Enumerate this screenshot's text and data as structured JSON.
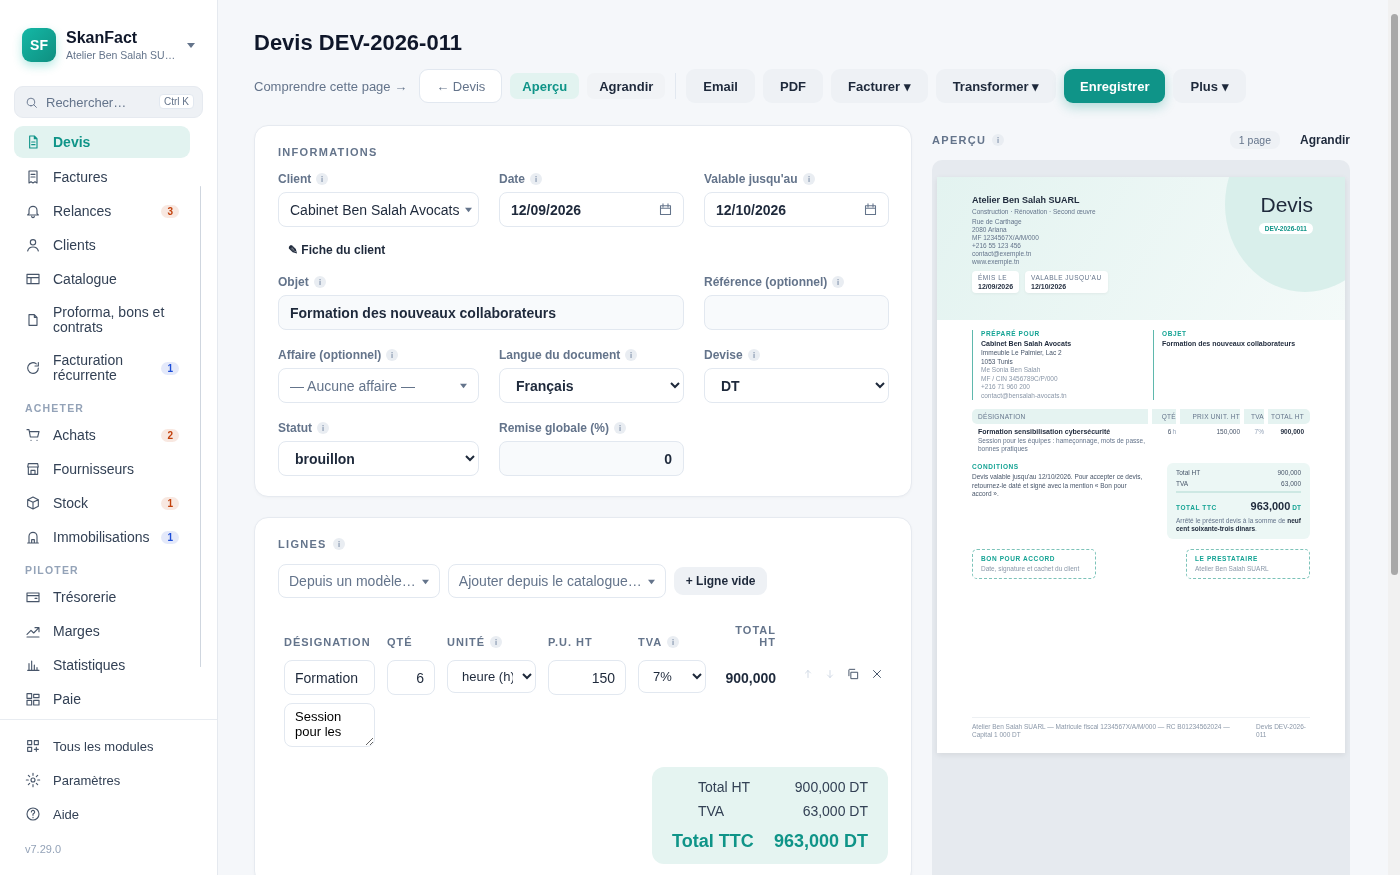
{
  "app": {
    "logo": "SF",
    "name": "SkanFact",
    "company": "Atelier Ben Salah SU…"
  },
  "search": {
    "placeholder": "Rechercher…",
    "shortcut": "Ctrl K"
  },
  "nav": [
    {
      "kind": "item",
      "label": "Devis",
      "selected": true
    },
    {
      "kind": "item",
      "label": "Factures",
      "selected": false
    },
    {
      "kind": "item",
      "label": "Relances",
      "selected": false,
      "badge": "3",
      "color": "#c2410c"
    },
    {
      "kind": "item",
      "label": "Clients",
      "selected": false
    },
    {
      "kind": "item",
      "label": "Catalogue",
      "selected": false
    },
    {
      "kind": "item",
      "label": "Proforma, bons et contrats",
      "selected": false
    },
    {
      "kind": "item",
      "label": "Facturation récurrente",
      "selected": false,
      "badge": "1",
      "color": "#1d4ed8"
    },
    {
      "kind": "section",
      "label": "ACHETER"
    },
    {
      "kind": "item",
      "label": "Achats",
      "selected": false,
      "badge": "2",
      "color": "#c2410c"
    },
    {
      "kind": "item",
      "label": "Fournisseurs",
      "selected": false
    },
    {
      "kind": "item",
      "label": "Stock",
      "selected": false,
      "badge": "1",
      "color": "#c2410c"
    },
    {
      "kind": "item",
      "label": "Immobilisations",
      "selected": false,
      "badge": "1",
      "color": "#1d4ed8"
    },
    {
      "kind": "section",
      "label": "PILOTER"
    },
    {
      "kind": "item",
      "label": "Trésorerie",
      "selected": false
    },
    {
      "kind": "item",
      "label": "Marges",
      "selected": false
    },
    {
      "kind": "item",
      "label": "Statistiques",
      "selected": false
    },
    {
      "kind": "item",
      "label": "Paie",
      "selected": false
    }
  ],
  "footer_nav": [
    {
      "label": "Tous les modules"
    },
    {
      "label": "Paramètres"
    },
    {
      "label": "Aide"
    }
  ],
  "version": "v7.29.0",
  "page": {
    "title": "Devis DEV-2026-011"
  },
  "toolbar": [
    {
      "kind": "link",
      "label": "Comprendre cette page →"
    },
    {
      "kind": "back",
      "label": "← Devis"
    },
    {
      "kind": "toggle",
      "label": "Aperçu",
      "selected": true
    },
    {
      "kind": "toggle",
      "label": "Agrandir",
      "selected": false
    },
    {
      "kind": "action",
      "label": "Email"
    },
    {
      "kind": "action",
      "label": "PDF"
    },
    {
      "kind": "action",
      "label": "Facturer ▾"
    },
    {
      "kind": "action",
      "label": "Transformer ▾"
    },
    {
      "kind": "primary",
      "label": "Enregistrer"
    },
    {
      "kind": "action",
      "label": "Plus ▾"
    }
  ],
  "informations": {
    "title": "INFORMATIONS",
    "fields": [
      {
        "kind": "select",
        "label": "Client",
        "info": true,
        "value": "Cabinet Ben Salah Avocats"
      },
      {
        "kind": "date",
        "label": "Date",
        "info": true,
        "value": "12/09/2026"
      },
      {
        "kind": "date",
        "label": "Valable jusqu'au",
        "info": true,
        "value": "12/10/2026"
      },
      {
        "kind": "link",
        "label": "✎ Fiche du client"
      },
      {
        "kind": "wide",
        "label": "Objet",
        "info": true,
        "value": "Formation des nouveaux collaborateurs"
      },
      {
        "kind": "text",
        "label": "Référence (optionnel)",
        "info": true
      },
      {
        "kind": "select",
        "label": "Affaire (optionnel)",
        "info": true,
        "placeholder": "— Aucune affaire —"
      },
      {
        "kind": "dropdown",
        "label": "Langue du document",
        "info": true,
        "value": "Français"
      },
      {
        "kind": "dropdown",
        "label": "Devise",
        "info": true,
        "value": "DT"
      },
      {
        "kind": "dropdown",
        "label": "Statut",
        "info": true,
        "value": "brouillon"
      },
      {
        "kind": "number",
        "label": "Remise globale (%)",
        "info": true,
        "value": "0"
      }
    ]
  },
  "lignes": {
    "title": "LIGNES",
    "info": true,
    "tools": [
      {
        "kind": "select",
        "placeholder": "Depuis un modèle…"
      },
      {
        "kind": "select",
        "placeholder": "Ajouter depuis le catalogue…"
      },
      {
        "kind": "button",
        "label": "+ Ligne vide"
      }
    ],
    "columns": [
      {
        "label": "DÉSIGNATION"
      },
      {
        "label": "QTÉ"
      },
      {
        "label": "UNITÉ",
        "info": true
      },
      {
        "label": "P.U. HT"
      },
      {
        "label": "TVA",
        "info": true
      },
      {
        "label": "TOTAL HT"
      }
    ],
    "rows": [
      {
        "designation": "Formation",
        "description": "Session pour les",
        "qty": "6",
        "unit": "heure (h)",
        "price": "150",
        "tva": "7%",
        "total": "900,000"
      }
    ],
    "totals": [
      {
        "kind": "line",
        "label": "Total HT",
        "value": "900,000 DT"
      },
      {
        "kind": "line",
        "label": "TVA",
        "value": "63,000 DT"
      },
      {
        "kind": "grand",
        "label": "Total TTC",
        "value": "963,000 DT"
      }
    ]
  },
  "preview": {
    "title": "APERÇU",
    "info": true,
    "pages": "1 page",
    "expand": "Agrandir",
    "document": {
      "company": "Atelier Ben Salah SUARL",
      "tagline": "Construction · Rénovation · Second œuvre",
      "address": [
        "Rue de Carthage",
        "2080 Ariana",
        "MF 1234567X/A/M/000",
        "+216 55 123 456",
        "contact@exemple.tn",
        "www.exemple.tn"
      ],
      "title": "Devis",
      "number": "DEV-2026-011",
      "dates": [
        {
          "label": "ÉMIS LE",
          "value": "12/09/2026"
        },
        {
          "label": "VALABLE JUSQU'AU",
          "value": "12/10/2026"
        }
      ],
      "client": {
        "label": "PRÉPARÉ POUR",
        "name": "Cabinet Ben Salah Avocats",
        "lines": [
          "Immeuble Le Palmier, Lac 2",
          "1053 Tunis"
        ],
        "contact": [
          "Me Sonia Ben Salah",
          "MF / CIN 3456789C/P/000",
          "+216 71 960 200",
          "contact@bensalah-avocats.tn"
        ]
      },
      "subject": {
        "label": "OBJET",
        "text": "Formation des nouveaux collaborateurs"
      },
      "columns": [
        "DÉSIGNATION",
        "QTÉ",
        "PRIX UNIT. HT",
        "TVA",
        "TOTAL HT"
      ],
      "rows": [
        {
          "name": "Formation sensibilisation cybersécurité",
          "description": "Session pour les équipes : hameçonnage, mots de passe, bonnes pratiques",
          "qty": "6",
          "unit": "h",
          "price": "150,000",
          "tva": "7%",
          "total": "900,000"
        }
      ],
      "conditions": {
        "label": "CONDITIONS",
        "text": "Devis valable jusqu'au 12/10/2026. Pour accepter ce devis, retournez-le daté et signé avec la mention « Bon pour accord »."
      },
      "totals": [
        {
          "label": "Total HT",
          "value": "900,000"
        },
        {
          "label": "TVA",
          "value": "63,000"
        }
      ],
      "grand_total": {
        "label": "TOTAL TTC",
        "value": "963,000",
        "currency": "DT"
      },
      "amount_words": "Arrêté le présent devis à la somme de **neuf cent soixante-trois dinars**.",
      "signatures": [
        {
          "title": "BON POUR ACCORD",
          "text": "Date, signature et cachet du client"
        },
        {
          "title": "LE PRESTATAIRE",
          "text": "Atelier Ben Salah SUARL"
        }
      ],
      "footer": {
        "legal": "Atelier Ben Salah SUARL — Matricule fiscal 1234567X/A/M/000 — RC B01234562024 — Capital 1 000 DT",
        "reference": "Devis DEV-2026-011"
      }
    }
  }
}
